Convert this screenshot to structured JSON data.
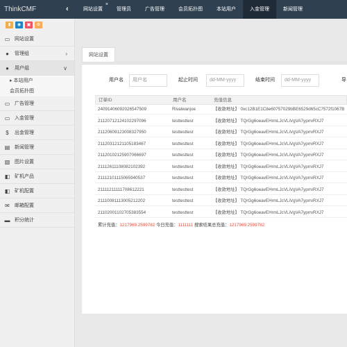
{
  "app": {
    "title": "ThinkCMF"
  },
  "topnav": [
    {
      "label": "网站设置",
      "closable": true,
      "active": false
    },
    {
      "label": "管理员",
      "active": false
    },
    {
      "label": "广告管理",
      "active": false
    },
    {
      "label": "会员拓扑图",
      "active": false
    },
    {
      "label": "本站用户",
      "active": false
    },
    {
      "label": "入金管理",
      "active": true
    },
    {
      "label": "新闻管理",
      "active": false
    }
  ],
  "sidebar": {
    "quick_colors": [
      "#f0ad4e",
      "#1c84c6",
      "#ed5565",
      "#f8ac59"
    ],
    "items": [
      {
        "label": "网站设置",
        "icon": "monitor-icon"
      },
      {
        "label": "管理组",
        "icon": "group-icon",
        "arrow": "›"
      },
      {
        "label": "用户组",
        "icon": "user-icon",
        "arrow": "∨"
      },
      {
        "label": "广告管理",
        "icon": "picture-icon"
      },
      {
        "label": "入金管理",
        "icon": "card-icon"
      },
      {
        "label": "出金管理",
        "icon": "dollar-icon"
      },
      {
        "label": "新闻管理",
        "icon": "news-icon"
      },
      {
        "label": "图片设置",
        "icon": "image-icon"
      },
      {
        "label": "矿机产品",
        "icon": "machine-icon"
      },
      {
        "label": "矿机配置",
        "icon": "machine-config-icon"
      },
      {
        "label": "邮箱配置",
        "icon": "mail-icon"
      },
      {
        "label": "积分统计",
        "icon": "vista-icon"
      }
    ],
    "subitems": [
      {
        "label": "▸ 本站用户"
      },
      {
        "label": "会员拓扑图"
      }
    ]
  },
  "main": {
    "tab": "网站设置",
    "search": {
      "username_label": "用户名",
      "username_placeholder": "用户名",
      "start_label": "起止时间",
      "start_placeholder": "dd-MM-yyyy",
      "end_label": "结束时间",
      "end_placeholder": "dd-MM-yyyy",
      "extra_label": "导"
    },
    "table": {
      "headers": [
        "订单ID",
        "用户名",
        "充值信息"
      ],
      "rows": [
        {
          "id": "24091406092026547509",
          "user": "Rivalwanjoe",
          "info": "【收款地址】 0xc12B1E1C8e60757029bBE6529d65cC7572f1067B"
        },
        {
          "id": "21120712124102297096",
          "user": "testtesttest",
          "info": "【收款地址】 TQrGg6oeavEHrmLJcVLiVgVA7yprrvRXJ7"
        },
        {
          "id": "21120609123008327950",
          "user": "testtesttest",
          "info": "【收款地址】 TQrGg6oeavEHrmLJcVLiVgVA7yprrvRXJ7"
        },
        {
          "id": "21120312121105183467",
          "user": "testtesttest",
          "info": "【收款地址】 TQrGg6oeavEHrmLJcVLiVgVA7yprrvRXJ7"
        },
        {
          "id": "21120102125907066697",
          "user": "testtesttest",
          "info": "【收款地址】 TQrGg6oeavEHrmLJcVLiVgVA7yprrvRXJ7"
        },
        {
          "id": "21112611108082102392",
          "user": "testtesttest",
          "info": "【收款地址】 TQrGg6oeavEHrmLJcVLiVgVA7yprrvRXJ7"
        },
        {
          "id": "21112101115065940537",
          "user": "testtesttest",
          "info": "【收款地址】 TQrGg6oeavEHrmLJcVLiVgVA7yprrvRXJ7"
        },
        {
          "id": "21111211111708612221",
          "user": "testtesttest",
          "info": "【收款地址】 TQrGg6oeavEHrmLJcVLiVgVA7yprrvRXJ7"
        },
        {
          "id": "21110081113005212202",
          "user": "testtesttest",
          "info": "【收款地址】 TQrGg6oeavEHrmLJcVLiVgVA7yprrvRXJ7"
        },
        {
          "id": "21102001102705383554",
          "user": "testtesttest",
          "info": "【收款地址】 TQrGg6oeavEHrmLJcVLiVgVA7yprrvRXJ7"
        }
      ],
      "summary": {
        "total_label": "累计充值：",
        "total_value": "1217969.2599782",
        "today_label": " 今日充值：",
        "today_value": "1111111",
        "search_label": " 搜索结果总充值：",
        "search_value": "1217969.2599782"
      }
    }
  }
}
